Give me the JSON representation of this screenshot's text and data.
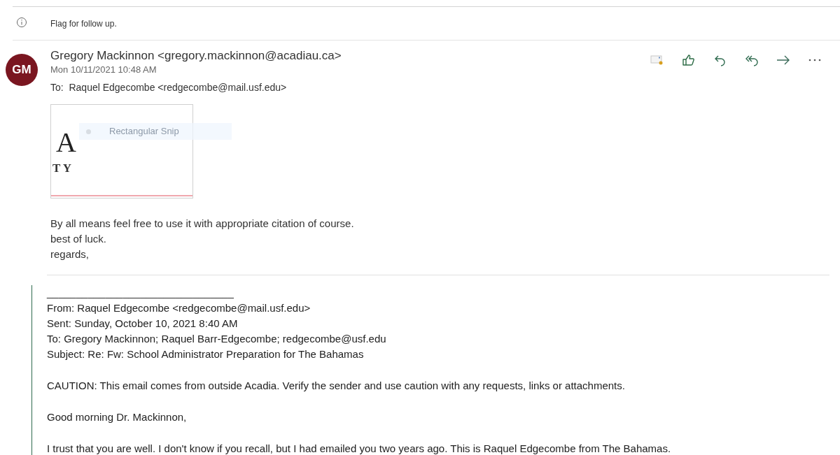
{
  "info_bar": {
    "text": "Flag for follow up."
  },
  "message": {
    "avatar_initials": "GM",
    "sender": "Gregory Mackinnon <gregory.mackinnon@acadiau.ca>",
    "date": "Mon 10/11/2021 10:48 AM",
    "to": "To:  Raquel Edgecombe <redgecombe@mail.usf.edu>",
    "toolbar": [
      {
        "kind": "envelope"
      },
      {
        "kind": "like"
      },
      {
        "kind": "reply"
      },
      {
        "kind": "reply_all"
      },
      {
        "kind": "forward"
      },
      {
        "kind": "more"
      }
    ],
    "attachment_snip": {
      "big_letter": "A",
      "small_letters": "T Y",
      "overlay_label": "Rectangular Snip"
    },
    "body": [
      "By all means feel free to use it with appropriate citation of course.",
      "best of luck.",
      "regards,"
    ]
  },
  "quoted": {
    "separator": "________________________________",
    "header": [
      "From: Raquel Edgecombe <redgecombe@mail.usf.edu>",
      "Sent: Sunday, October 10, 2021 8:40 AM",
      "To: Gregory Mackinnon; Raquel Barr-Edgecombe; redgecombe@usf.edu",
      "Subject: Re: Fw: School Administrator Preparation for The Bahamas"
    ],
    "paragraphs": [
      "CAUTION: This email comes from outside Acadia. Verify the sender and use caution with any requests, links or attachments.",
      "Good morning Dr. Mackinnon,",
      "I trust that you are well. I don't know if you recall, but I had emailed you two years ago. This is Raquel Edgecombe from The Bahamas."
    ]
  }
}
